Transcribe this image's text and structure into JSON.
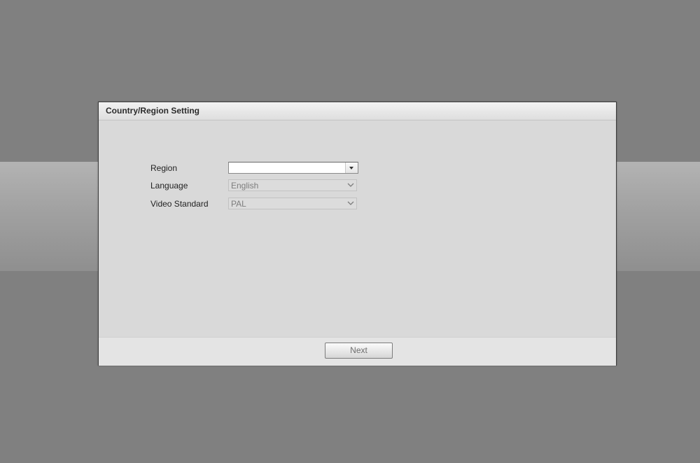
{
  "dialog": {
    "title": "Country/Region Setting"
  },
  "form": {
    "region": {
      "label": "Region",
      "value": ""
    },
    "language": {
      "label": "Language",
      "value": "English"
    },
    "video_standard": {
      "label": "Video Standard",
      "value": "PAL"
    }
  },
  "footer": {
    "next_label": "Next"
  },
  "icons": {
    "region_dropdown": "triangle-down-icon",
    "language_dropdown": "chevron-down-icon",
    "video_standard_dropdown": "chevron-down-icon"
  },
  "colors": {
    "background": "#808080",
    "dialog_body": "#d9d9d9",
    "disabled_text": "#7d7d7d"
  }
}
